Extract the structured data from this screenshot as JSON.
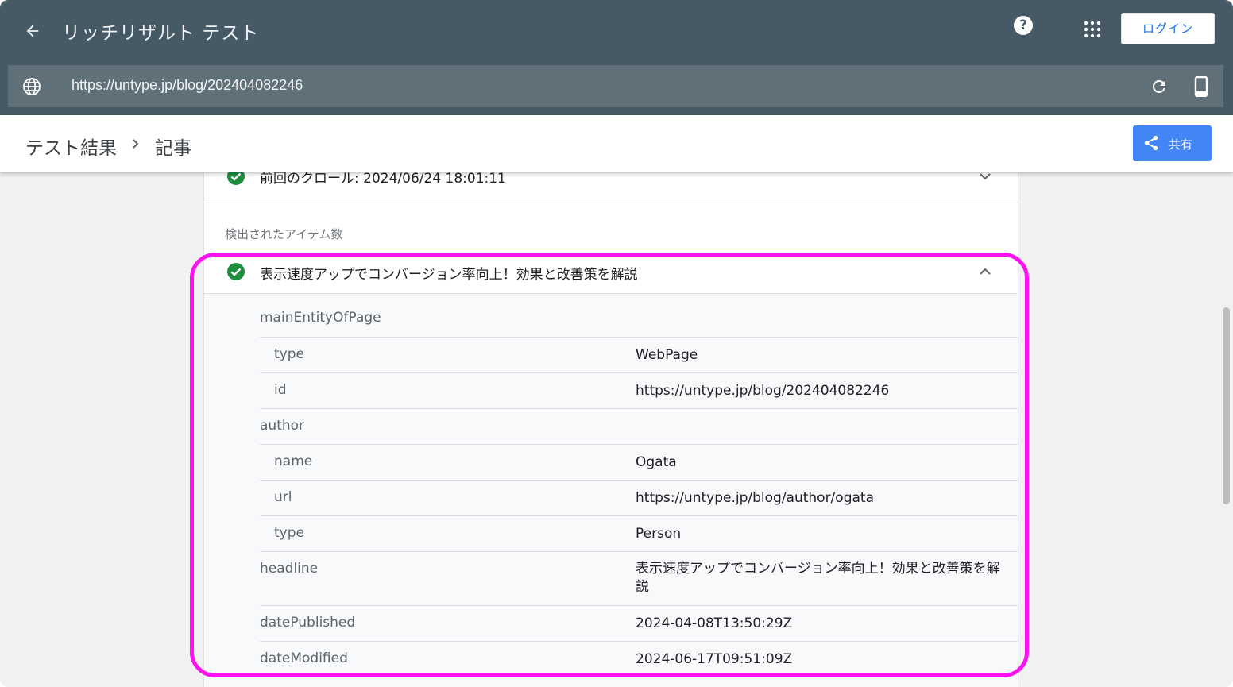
{
  "appbar": {
    "title": "リッチリザルト テスト",
    "help_label": "?",
    "login_label": "ログイン"
  },
  "urlbar": {
    "url": "https://untype.jp/blog/202404082246"
  },
  "breadcrumb": {
    "root": "テスト結果",
    "current": "記事",
    "share_label": "共有"
  },
  "card": {
    "crawl_text": "前回のクロール: 2024/06/24 18:01:11",
    "detected_label": "検出されたアイテム数",
    "item_title": "表示速度アップでコンバージョン率向上！効果と改善策を解説"
  },
  "details": [
    {
      "key": "mainEntityOfPage",
      "value": ""
    },
    {
      "key": "type",
      "value": "WebPage"
    },
    {
      "key": "id",
      "value": "https://untype.jp/blog/202404082246"
    },
    {
      "key": "author",
      "value": ""
    },
    {
      "key": "name",
      "value": "Ogata"
    },
    {
      "key": "url",
      "value": "https://untype.jp/blog/author/ogata"
    },
    {
      "key": "type",
      "value": "Person"
    },
    {
      "key": "headline",
      "value": "表示速度アップでコンバージョン率向上！効果と改善策を解説"
    },
    {
      "key": "datePublished",
      "value": "2024-04-08T13:50:29Z"
    },
    {
      "key": "dateModified",
      "value": "2024-06-17T09:51:09Z"
    }
  ],
  "colors": {
    "appbar": "#455a64",
    "urlbar": "#5f7079",
    "success": "#1e8e3e",
    "share": "#4285f4",
    "highlight": "#ff12f0"
  }
}
